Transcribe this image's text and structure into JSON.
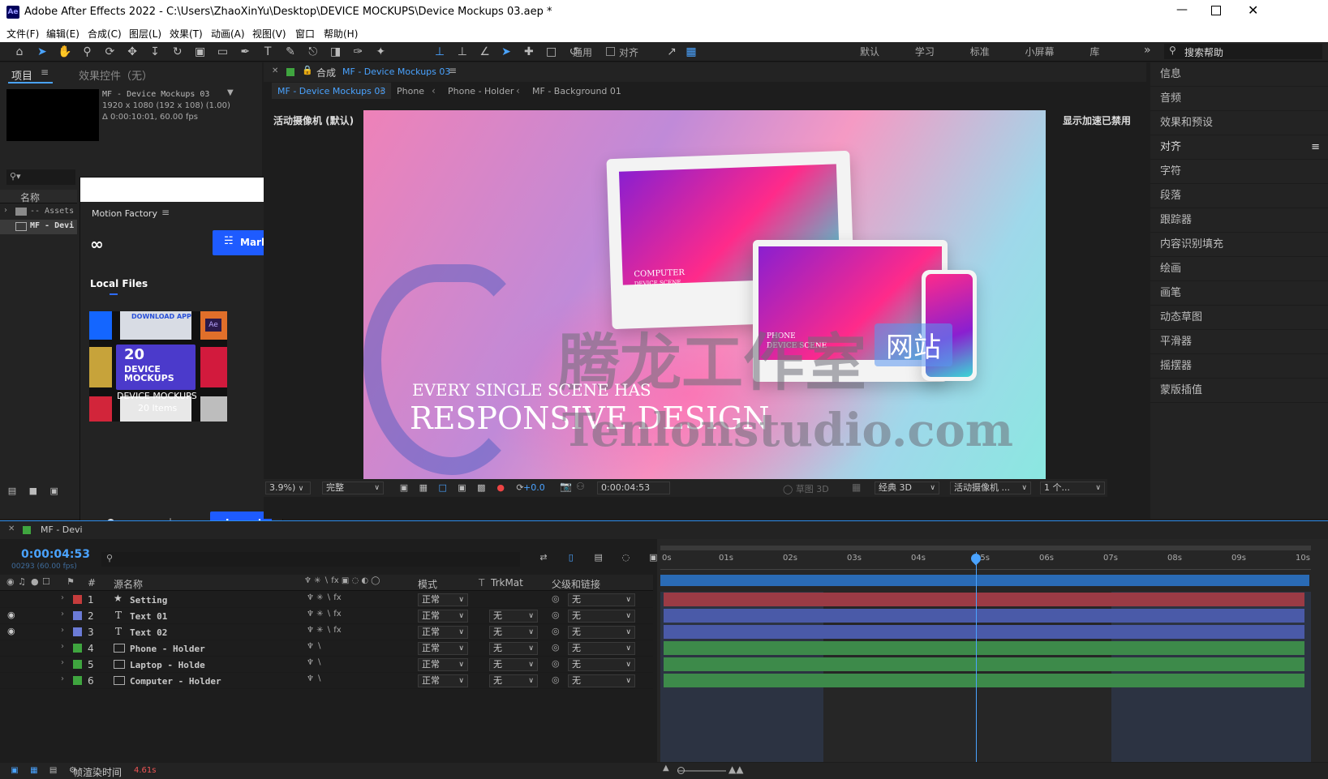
{
  "titlebar": {
    "app_icon": "Ae",
    "title": "Adobe After Effects 2022 - C:\\Users\\ZhaoXinYu\\Desktop\\DEVICE MOCKUPS\\Device Mockups 03.aep *"
  },
  "menu": [
    "文件(F)",
    "编辑(E)",
    "合成(C)",
    "图层(L)",
    "效果(T)",
    "动画(A)",
    "视图(V)",
    "窗口",
    "帮助(H)"
  ],
  "toolbar": {
    "generic": "通用",
    "align": "对齐",
    "workspaces": [
      "默认",
      "学习",
      "标准",
      "小屏幕",
      "库"
    ],
    "search_placeholder": "搜索帮助"
  },
  "project": {
    "tab_project": "项目",
    "tab_effects": "效果控件（无）",
    "comp_name": "MF - Device Mockups 03",
    "comp_res": "1920 x 1080  (192 x 108) (1.00)",
    "comp_dur": "Δ 0:00:10:01, 60.00 fps",
    "col_name": "名称",
    "items": [
      "-- Assets",
      "MF - Devi"
    ]
  },
  "plugin": {
    "title": "Motion Factory",
    "market_label": "Market",
    "local_files": "Local Files",
    "card_title": "DEVICE MOCKUPS",
    "card_count": "20 Items",
    "tile_20": "20",
    "tile_device": "DEVICE",
    "tile_mockups": "MOCKUPS",
    "tile_download": "DOWNLOAD APP",
    "tile_ae": "Ae",
    "import_label": "Import"
  },
  "comp": {
    "tab_prefix": "合成",
    "tab_name": "MF - Device Mockups 03",
    "breadcrumbs": [
      "MF - Device Mockups 03",
      "Phone",
      "Phone - Holder",
      "MF - Background 01"
    ],
    "camera_label": "活动摄像机 (默认)",
    "accel_label": "显示加速已禁用",
    "scene": {
      "computer_line1": "COMPUTER",
      "computer_line2": "DEVICE SCENE",
      "phone_line1": "PHONE",
      "phone_line2": "DEVICE SCENE",
      "headline_small": "EVERY SINGLE SCENE HAS",
      "headline_big": "RESPONSIVE DESIGN"
    },
    "watermark_cn": "腾龙工作室",
    "watermark_badge": "网站",
    "watermark_url": "Tenlonstudio.com",
    "footer": {
      "zoom": "3.9%)",
      "quality": "完整",
      "exposure": "+0.0",
      "timecode": "0:00:04:53",
      "draft": "草图 3D",
      "renderer": "经典 3D",
      "camera": "活动摄像机 ...",
      "views": "1 个..."
    }
  },
  "right_panel": [
    "信息",
    "音频",
    "效果和预设",
    "对齐",
    "字符",
    "段落",
    "跟踪器",
    "内容识别填充",
    "绘画",
    "画笔",
    "动态草图",
    "平滑器",
    "摇摆器",
    "蒙版插值"
  ],
  "timeline": {
    "tab_name": "MF - Devi",
    "timecode": "0:00:04:53",
    "frames": "00293 (60.00 fps)",
    "headers": {
      "num": "#",
      "name": "源名称",
      "mode": "模式",
      "t": "T",
      "trkmat": "TrkMat",
      "parent": "父级和链接"
    },
    "ruler": [
      "0s",
      "01s",
      "02s",
      "03s",
      "04s",
      "05s",
      "06s",
      "07s",
      "08s",
      "09s",
      "10s"
    ],
    "layers": [
      {
        "num": "1",
        "name": "Setting",
        "mode": "正常",
        "trk": "",
        "parent": "无",
        "label": "#c53c3c",
        "bar": "#9b3b45"
      },
      {
        "num": "2",
        "name": "Text 01",
        "mode": "正常",
        "trk": "无",
        "parent": "无",
        "label": "#6b7bd6",
        "bar": "#4a5aa8"
      },
      {
        "num": "3",
        "name": "Text 02",
        "mode": "正常",
        "trk": "无",
        "parent": "无",
        "label": "#6b7bd6",
        "bar": "#4a5aa8"
      },
      {
        "num": "4",
        "name": "Phone - Holder",
        "mode": "正常",
        "trk": "无",
        "parent": "无",
        "label": "#3fa53f",
        "bar": "#3d8a4a"
      },
      {
        "num": "5",
        "name": "Laptop - Holde",
        "mode": "正常",
        "trk": "无",
        "parent": "无",
        "label": "#3fa53f",
        "bar": "#3d8a4a"
      },
      {
        "num": "6",
        "name": "Computer - Holder",
        "mode": "正常",
        "trk": "无",
        "parent": "无",
        "label": "#3fa53f",
        "bar": "#3d8a4a"
      }
    ],
    "render_label": "帧渲染时间",
    "render_value": "4.61s"
  },
  "colors": {
    "accent": "#2d8ceb",
    "blue_btn": "#1e5bff",
    "bg": "#1d1d1d"
  }
}
